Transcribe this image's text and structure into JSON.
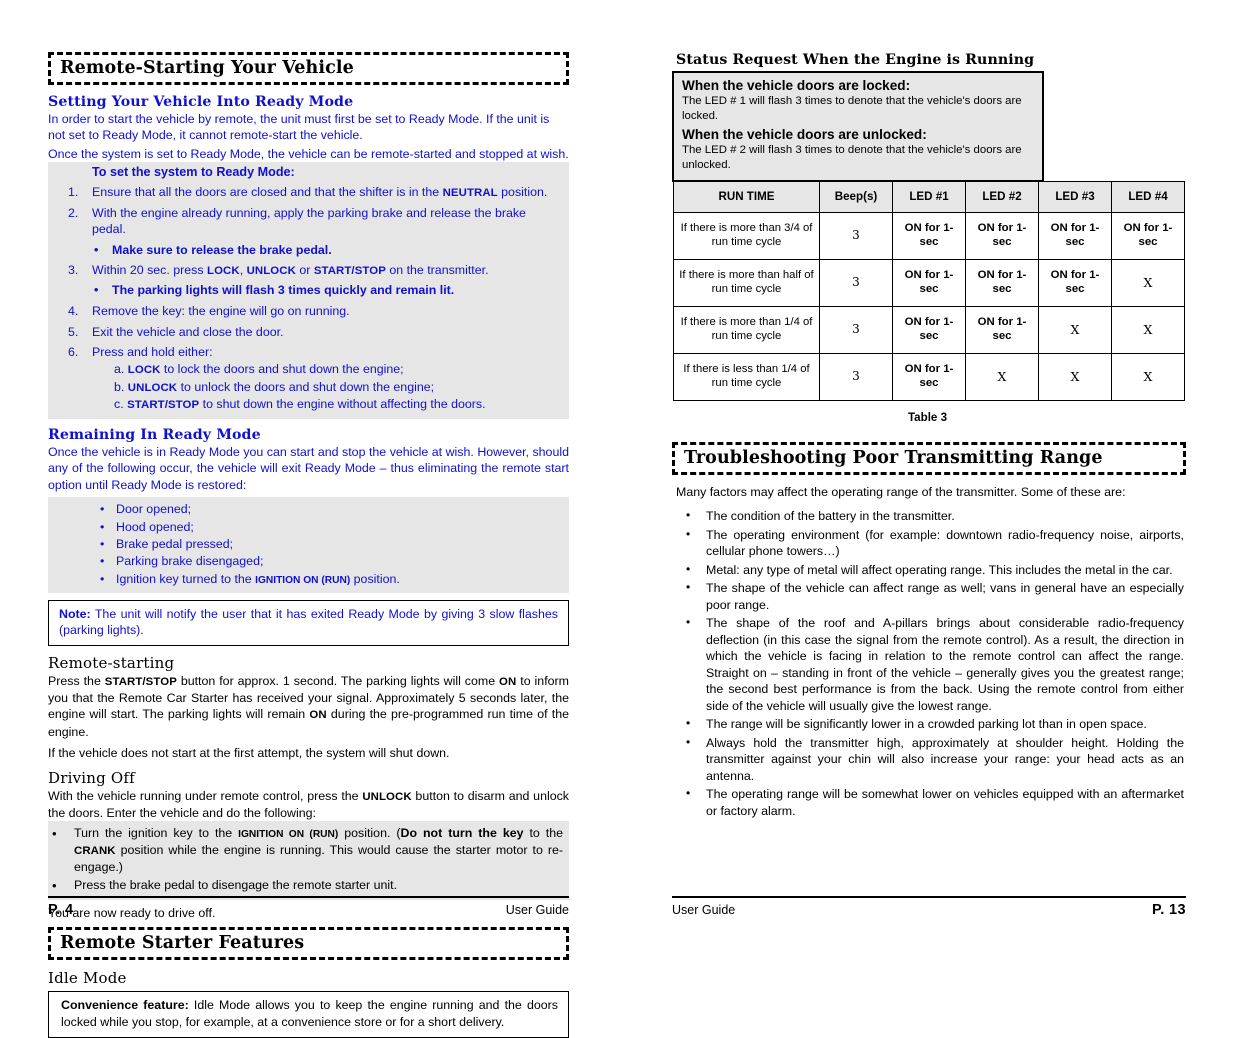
{
  "left_page": {
    "section_title": "Remote-Starting Your Vehicle",
    "ready_mode": {
      "heading": "Setting Your Vehicle Into Ready Mode",
      "paragraph1": "In order to start the vehicle by remote, the unit must first be set to Ready Mode. If the unit is not set to Ready Mode, it cannot remote-start the vehicle.",
      "paragraph2": "Once the system is set to Ready Mode, the vehicle can be remote-started and stopped at wish.",
      "steps_title": "To set the system to Ready Mode:",
      "step1_num": "1.",
      "step1_pre": "Ensure that all the doors are closed and that the shifter is in the ",
      "step1_sc": "NEUTRAL",
      "step1_post": " position.",
      "step2_num": "2.",
      "step2_text": "With the engine already running, apply the parking brake and release the brake pedal.",
      "bullet_a": "Make sure to release the brake pedal.",
      "step3_num": "3.",
      "step3_pre": "Within 20 sec. press ",
      "step3_sc1": "LOCK",
      "step3_mid1": ", ",
      "step3_sc2": "UNLOCK",
      "step3_mid2": " or ",
      "step3_sc3": "START/STOP",
      "step3_post": " on the transmitter.",
      "bullet_b": "The parking lights will flash 3 times quickly and remain lit.",
      "step4_num": "4.",
      "step4_text": "Remove the key: the engine will go on running.",
      "step5_num": "5.",
      "step5_text": "Exit the vehicle and close the door.",
      "step6_num": "6.",
      "step6_text": "Press and hold either:",
      "step6a_label": "a.",
      "step6a_sc": "LOCK",
      "step6a_text": " to lock the doors and shut down the engine;",
      "step6b_label": "b.",
      "step6b_sc": "UNLOCK",
      "step6b_text": " to unlock the doors and shut down the engine;",
      "step6c_label": "c.",
      "step6c_sc": "START/STOP",
      "step6c_text": " to shut down the engine without affecting the doors."
    },
    "remaining": {
      "heading": "Remaining In Ready Mode",
      "paragraph": "Once the vehicle is in Ready Mode you can start and stop the vehicle at wish. However, should any of the following occur, the vehicle will exit Ready Mode – thus eliminating the remote start option until Ready Mode is restored:",
      "items": [
        "Door opened;",
        "Hood opened;",
        "Brake pedal pressed;",
        "Parking brake disengaged;"
      ],
      "last_item_pre": "Ignition key turned to the ",
      "last_item_sc": "IGNITION ON (RUN)",
      "last_item_post": " position.",
      "note_label": "Note:",
      "note_text": " The unit will notify the user that it has exited Ready Mode by giving 3 slow flashes (parking lights)."
    },
    "remote_starting": {
      "heading": "Remote-starting",
      "p1_a": "Press the ",
      "p1_sc1": "START/STOP",
      "p1_b": " button for approx. 1 second. The parking lights will come ",
      "p1_sc2": "ON",
      "p1_c": " to inform you that the Remote Car Starter has received your signal. Approximately 5 seconds later, the engine will start. The parking lights will remain ",
      "p1_sc3": "ON",
      "p1_d": " during the pre-programmed run time of the engine.",
      "p2": "If the vehicle does not start at the first attempt, the system will shut down."
    },
    "driving_off": {
      "heading": "Driving Off",
      "p1_a": "With the vehicle running under remote control, press the ",
      "p1_sc": "UNLOCK",
      "p1_b": " button to disarm and unlock the doors. Enter the vehicle and do the following:",
      "item1_a": "Turn the ignition key to the ",
      "item1_sc1": "IGNITION ON (RUN)",
      "item1_b": " position. (",
      "item1_bold": "Do not turn the key",
      "item1_c": " to the ",
      "item1_sc2": "CRANK",
      "item1_d": " position while the engine is running. This would cause the starter motor to re-engage.)",
      "item2": "Press the brake pedal to disengage the remote starter unit.",
      "closing": "You are now ready to drive off."
    },
    "features": {
      "section_title": "Remote Starter Features",
      "idle_heading": "Idle Mode",
      "conv_label": "Convenience feature:",
      "conv_text": " Idle Mode allows you to keep the engine running and the doors locked while you stop, for example, at a convenience store or for a short delivery."
    },
    "footer": {
      "page": "P. 4",
      "guide": "User Guide"
    }
  },
  "right_page": {
    "status_request": {
      "heading": "Status Request When the Engine is Running",
      "locked_title": "When the vehicle doors are locked:",
      "locked_text": "The LED # 1 will flash 3 times to denote that the vehicle's doors are locked.",
      "unlocked_title": "When the vehicle doors are unlocked:",
      "unlocked_text": "The LED # 2 will flash 3 times to denote that the vehicle's doors are unlocked."
    },
    "table": {
      "headers": [
        "RUN TIME",
        "Beep(s)",
        "LED #1",
        "LED #2",
        "LED #3",
        "LED #4"
      ],
      "rows": [
        {
          "run_time": "If there is more than 3/4 of run time cycle",
          "beeps": "3",
          "led1": "ON for 1-sec",
          "led2": "ON for 1-sec",
          "led3": "ON for 1-sec",
          "led4": "ON for 1-sec"
        },
        {
          "run_time": "If there is more than half of run time cycle",
          "beeps": "3",
          "led1": "ON for 1-sec",
          "led2": "ON for 1-sec",
          "led3": "ON for 1-sec",
          "led4": "X"
        },
        {
          "run_time": "If there is more than 1/4 of run time cycle",
          "beeps": "3",
          "led1": "ON for 1-sec",
          "led2": "ON for 1-sec",
          "led3": "X",
          "led4": "X"
        },
        {
          "run_time": "If there is less than 1/4 of run time cycle",
          "beeps": "3",
          "led1": "ON for 1-sec",
          "led2": "X",
          "led3": "X",
          "led4": "X"
        }
      ],
      "caption": "Table 3"
    },
    "troubleshooting": {
      "section_title": "Troubleshooting Poor Transmitting Range",
      "intro": "Many factors may affect the operating range of the transmitter.  Some of these are:",
      "items": [
        "The condition of the battery in the transmitter.",
        "The operating environment (for example: downtown radio-frequency noise, airports, cellular phone towers…)",
        "Metal: any type of metal will affect operating range. This includes the metal in the car.",
        "The shape of the vehicle can affect range as well; vans in general have an especially poor range.",
        "The shape of the roof and A-pillars brings about considerable radio-frequency deflection (in this case the signal from the remote control). As a result, the direction in which the vehicle is facing in relation to the remote control can affect the range. Straight on – standing in front of the vehicle – generally gives you the greatest range; the second best performance is from the back. Using the remote control from either side of the vehicle will usually give the lowest range.",
        "The range will be significantly lower in a crowded parking lot than in open space.",
        "Always hold the transmitter high, approximately at shoulder height. Holding the transmitter against your chin will also increase your range: your head acts as an antenna.",
        "The operating range will be somewhat lower on vehicles equipped with an aftermarket or factory alarm."
      ]
    },
    "footer": {
      "guide": "User Guide",
      "page": "P. 13"
    }
  }
}
